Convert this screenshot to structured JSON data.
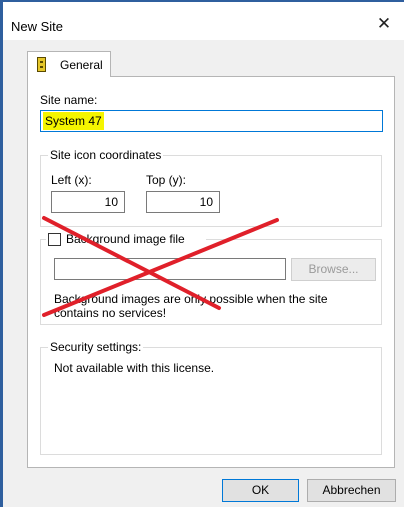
{
  "window": {
    "title": "New Site",
    "close_glyph": "✕"
  },
  "tabs": [
    {
      "label": "General",
      "icon": "site-icon"
    }
  ],
  "site_name": {
    "label": "Site name:",
    "value": "System 47"
  },
  "coordinates": {
    "group_title": "Site icon coordinates",
    "left": {
      "label": "Left (x):",
      "value": "10"
    },
    "top": {
      "label": "Top (y):",
      "value": "10"
    }
  },
  "background": {
    "checkbox_label": "Background image file",
    "checked": false,
    "path_value": "",
    "browse_label": "Browse...",
    "note_line1": "Background images are only possible when the site",
    "note_line2": "contains no services!"
  },
  "security": {
    "group_title": "Security settings:",
    "message": "Not available with this license."
  },
  "buttons": {
    "ok": "OK",
    "cancel": "Abbrechen"
  },
  "annotation": {
    "mark": "cross-out",
    "color": "#e0202a"
  }
}
